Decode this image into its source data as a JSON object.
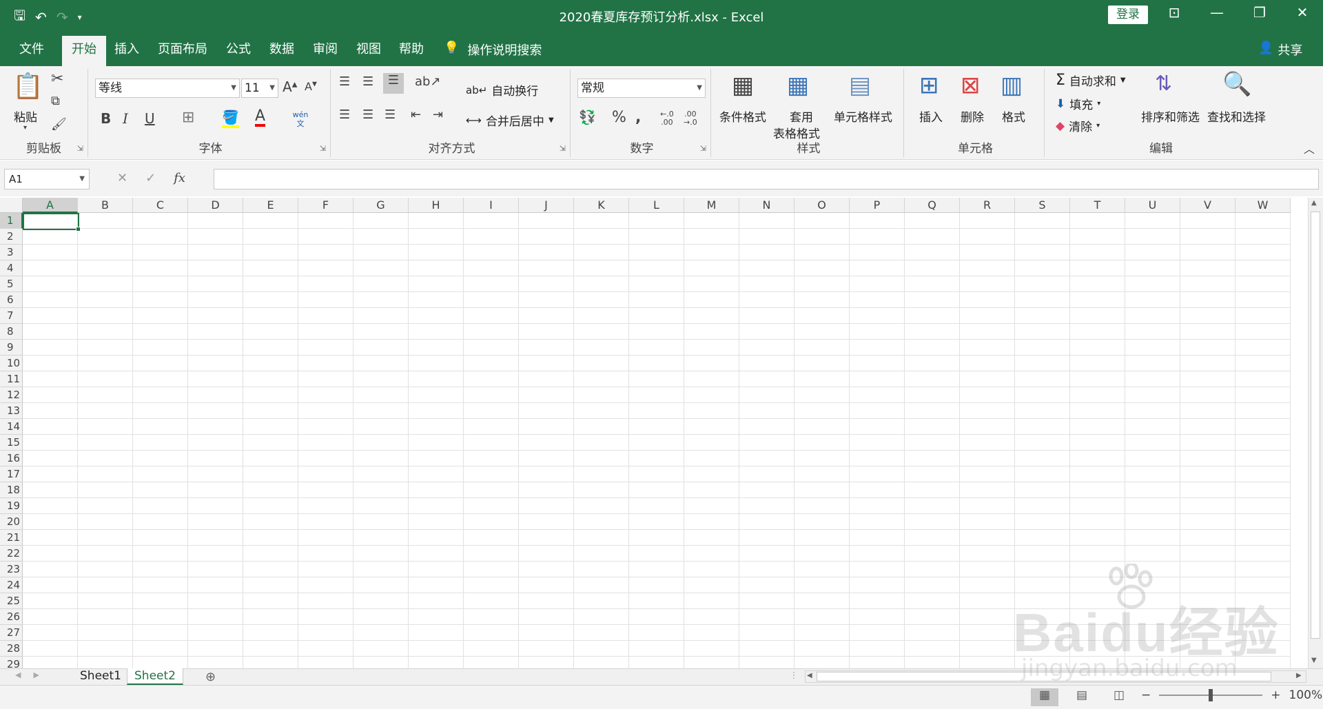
{
  "window": {
    "title": "2020春夏库存预订分析.xlsx  -  Excel",
    "login": "登录",
    "share": "共享"
  },
  "tabs": [
    "文件",
    "开始",
    "插入",
    "页面布局",
    "公式",
    "数据",
    "审阅",
    "视图",
    "帮助"
  ],
  "active_tab": "开始",
  "tell_me": "操作说明搜索",
  "ribbon": {
    "clipboard": {
      "label": "剪贴板",
      "paste": "粘贴"
    },
    "font": {
      "label": "字体",
      "name": "等线",
      "size": "11",
      "phonetic": "wén 文"
    },
    "alignment": {
      "label": "对齐方式",
      "wrap": "自动换行",
      "merge": "合并后居中"
    },
    "number": {
      "label": "数字",
      "format": "常规"
    },
    "styles": {
      "label": "样式",
      "conditional": "条件格式",
      "table_1": "套用",
      "table_2": "表格格式",
      "cell_styles": "单元格样式"
    },
    "cells": {
      "label": "单元格",
      "insert": "插入",
      "delete": "删除",
      "format": "格式"
    },
    "editing": {
      "label": "编辑",
      "autosum": "自动求和",
      "fill": "填充",
      "clear": "清除",
      "sort": "排序和筛选",
      "find": "查找和选择"
    }
  },
  "formula_bar": {
    "name_box": "A1",
    "fx": "fx",
    "value": ""
  },
  "columns": [
    "A",
    "B",
    "C",
    "D",
    "E",
    "F",
    "G",
    "H",
    "I",
    "J",
    "K",
    "L",
    "M",
    "N",
    "O",
    "P",
    "Q",
    "R",
    "S",
    "T",
    "U",
    "V",
    "W"
  ],
  "rows": [
    "1",
    "2",
    "3",
    "4",
    "5",
    "6",
    "7",
    "8",
    "9",
    "10",
    "11",
    "12",
    "13",
    "14",
    "15",
    "16",
    "17",
    "18",
    "19",
    "20",
    "21",
    "22",
    "23",
    "24",
    "25",
    "26",
    "27",
    "28",
    "29"
  ],
  "active_cell": "A1",
  "sheets": [
    "Sheet1",
    "Sheet2"
  ],
  "active_sheet": "Sheet2",
  "status": {
    "zoom": "100%"
  },
  "watermark": {
    "text": "Baidu经验",
    "url": "jingyan.baidu.com"
  },
  "colors": {
    "accent": "#217346"
  }
}
